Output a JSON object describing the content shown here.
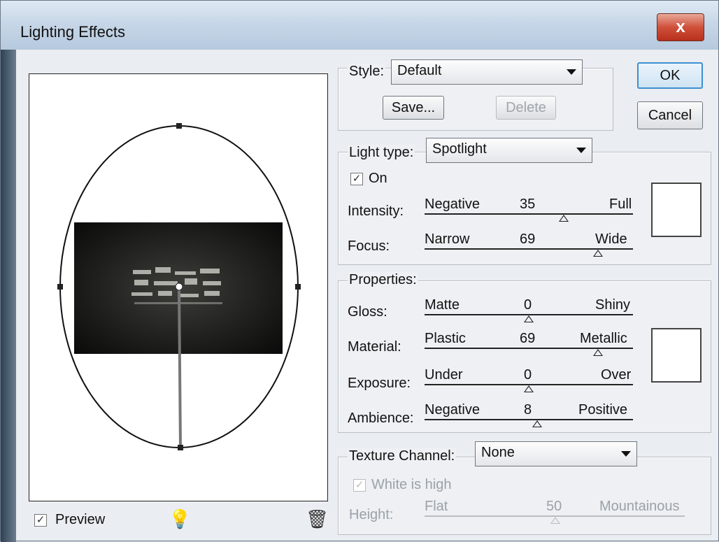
{
  "window": {
    "title": "Lighting Effects",
    "close_glyph": "x"
  },
  "buttons": {
    "ok": "OK",
    "cancel": "Cancel",
    "save": "Save...",
    "delete": "Delete"
  },
  "style": {
    "label": "Style:",
    "value": "Default"
  },
  "light": {
    "type_label": "Light type:",
    "type_value": "Spotlight",
    "on_label": "On",
    "on_checked": true,
    "intensity": {
      "label": "Intensity:",
      "min": "Negative",
      "max": "Full",
      "value": "35",
      "fraction": 0.67
    },
    "focus": {
      "label": "Focus:",
      "min": "Narrow",
      "max": "Wide",
      "value": "69",
      "fraction": 0.85
    }
  },
  "properties": {
    "header": "Properties:",
    "gloss": {
      "label": "Gloss:",
      "min": "Matte",
      "max": "Shiny",
      "value": "0",
      "fraction": 0.5
    },
    "material": {
      "label": "Material:",
      "min": "Plastic",
      "max": "Metallic",
      "value": "69",
      "fraction": 0.85
    },
    "exposure": {
      "label": "Exposure:",
      "min": "Under",
      "max": "Over",
      "value": "0",
      "fraction": 0.5
    },
    "ambience": {
      "label": "Ambience:",
      "min": "Negative",
      "max": "Positive",
      "value": "8",
      "fraction": 0.54
    }
  },
  "texture": {
    "label": "Texture Channel:",
    "value": "None",
    "white_high_label": "White is high",
    "white_high_checked": true,
    "height": {
      "label": "Height:",
      "min": "Flat",
      "max": "Mountainous",
      "value": "50",
      "fraction": 0.5
    }
  },
  "preview": {
    "label": "Preview",
    "checked": true
  },
  "icons": {
    "light_bulb": "light-bulb-icon",
    "trash": "trash-icon"
  },
  "colors": {
    "light_color": "#ffffff",
    "material_color": "#ffffff",
    "accent": "#3d8fd1"
  }
}
